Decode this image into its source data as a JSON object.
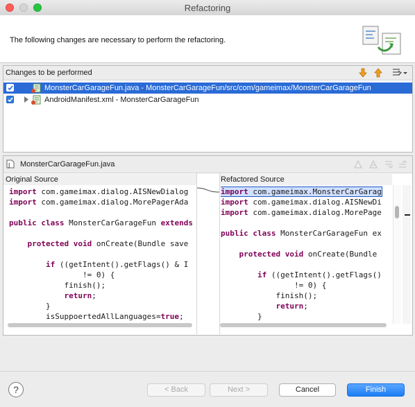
{
  "window": {
    "title": "Refactoring"
  },
  "header": {
    "message": "The following changes are necessary to perform the refactoring."
  },
  "changes": {
    "title": "Changes to be performed",
    "items": [
      {
        "label": "MonsterCarGarageFun.java - MonsterCarGarageFun/src/com/gameimax/MonsterCarGarageFun",
        "checked": true,
        "selected": true
      },
      {
        "label": "AndroidManifest.xml - MonsterCarGarageFun",
        "checked": true,
        "selected": false
      }
    ]
  },
  "compare": {
    "file_title": "MonsterCarGarageFun.java",
    "original_title": "Original Source",
    "refactored_title": "Refactored Source",
    "original_lines": [
      "import com.gameimax.dialog.AISNewDialog",
      "import com.gameimax.dialog.MorePagerAda",
      "",
      "public class MonsterCarGarageFun extends",
      "",
      "    protected void onCreate(Bundle save",
      "",
      "        if ((getIntent().getFlags() & I",
      "                != 0) {",
      "            finish();",
      "            return;",
      "        }",
      "        isSuppoertedAllLanguages=true;"
    ],
    "refactored_lines": [
      "import com.gameimax.MonsterCarGarag",
      "import com.gameimax.dialog.AISNewDi",
      "import com.gameimax.dialog.MorePage",
      "",
      "public class MonsterCarGarageFun ex",
      "",
      "    protected void onCreate(Bundle",
      "",
      "        if ((getIntent().getFlags()",
      "                != 0) {",
      "            finish();",
      "            return;",
      "        }"
    ]
  },
  "buttons": {
    "help": "?",
    "back": "< Back",
    "next": "Next >",
    "cancel": "Cancel",
    "finish": "Finish"
  },
  "colors": {
    "selection": "#2a6bd6",
    "keyword": "#7f0055",
    "default_button": "#1c7ef5"
  }
}
